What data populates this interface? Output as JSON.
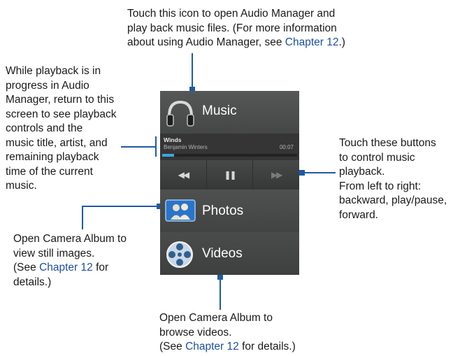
{
  "callouts": {
    "top": {
      "lines": [
        "Touch this icon to open Audio Manager and",
        "play back music files. (For more information",
        "about using Audio Manager, see "
      ],
      "ref": "Chapter 12",
      "tail": ".)"
    },
    "left": {
      "lines": [
        "While playback is in",
        "progress in Audio",
        "Manager, return to this",
        "screen to see playback",
        "controls and the",
        "music title, artist, and",
        "remaining playback",
        "time of the current",
        "music."
      ]
    },
    "right": {
      "lines": [
        "Touch these buttons",
        "to control music",
        "playback.",
        "From left to right:",
        "backward, play/pause,",
        "forward."
      ]
    },
    "photos": {
      "line1": "Open Camera Album to",
      "line2": "view still images.",
      "prefix": "(See ",
      "ref": "Chapter 12",
      "suffix": " for",
      "line4": "details.)"
    },
    "videos": {
      "line1": "Open Camera Album to",
      "line2": "browse videos.",
      "prefix": "(See ",
      "ref": "Chapter 12",
      "suffix": " for details.)"
    }
  },
  "phone": {
    "music_label": "Music",
    "now_playing": {
      "title": "Winds",
      "artist": "Benjamin Winters",
      "time": "00:07",
      "progress_fraction": 0.09
    },
    "controls": {
      "backward": "◀◀",
      "play_pause": "❚❚",
      "forward": "▶▶"
    },
    "photos_label": "Photos",
    "videos_label": "Videos"
  },
  "colors": {
    "accent": "#1f5aa6",
    "progress": "#3aa6e6"
  },
  "icons": [
    "headphones-icon",
    "photos-icon",
    "film-reel-icon"
  ]
}
